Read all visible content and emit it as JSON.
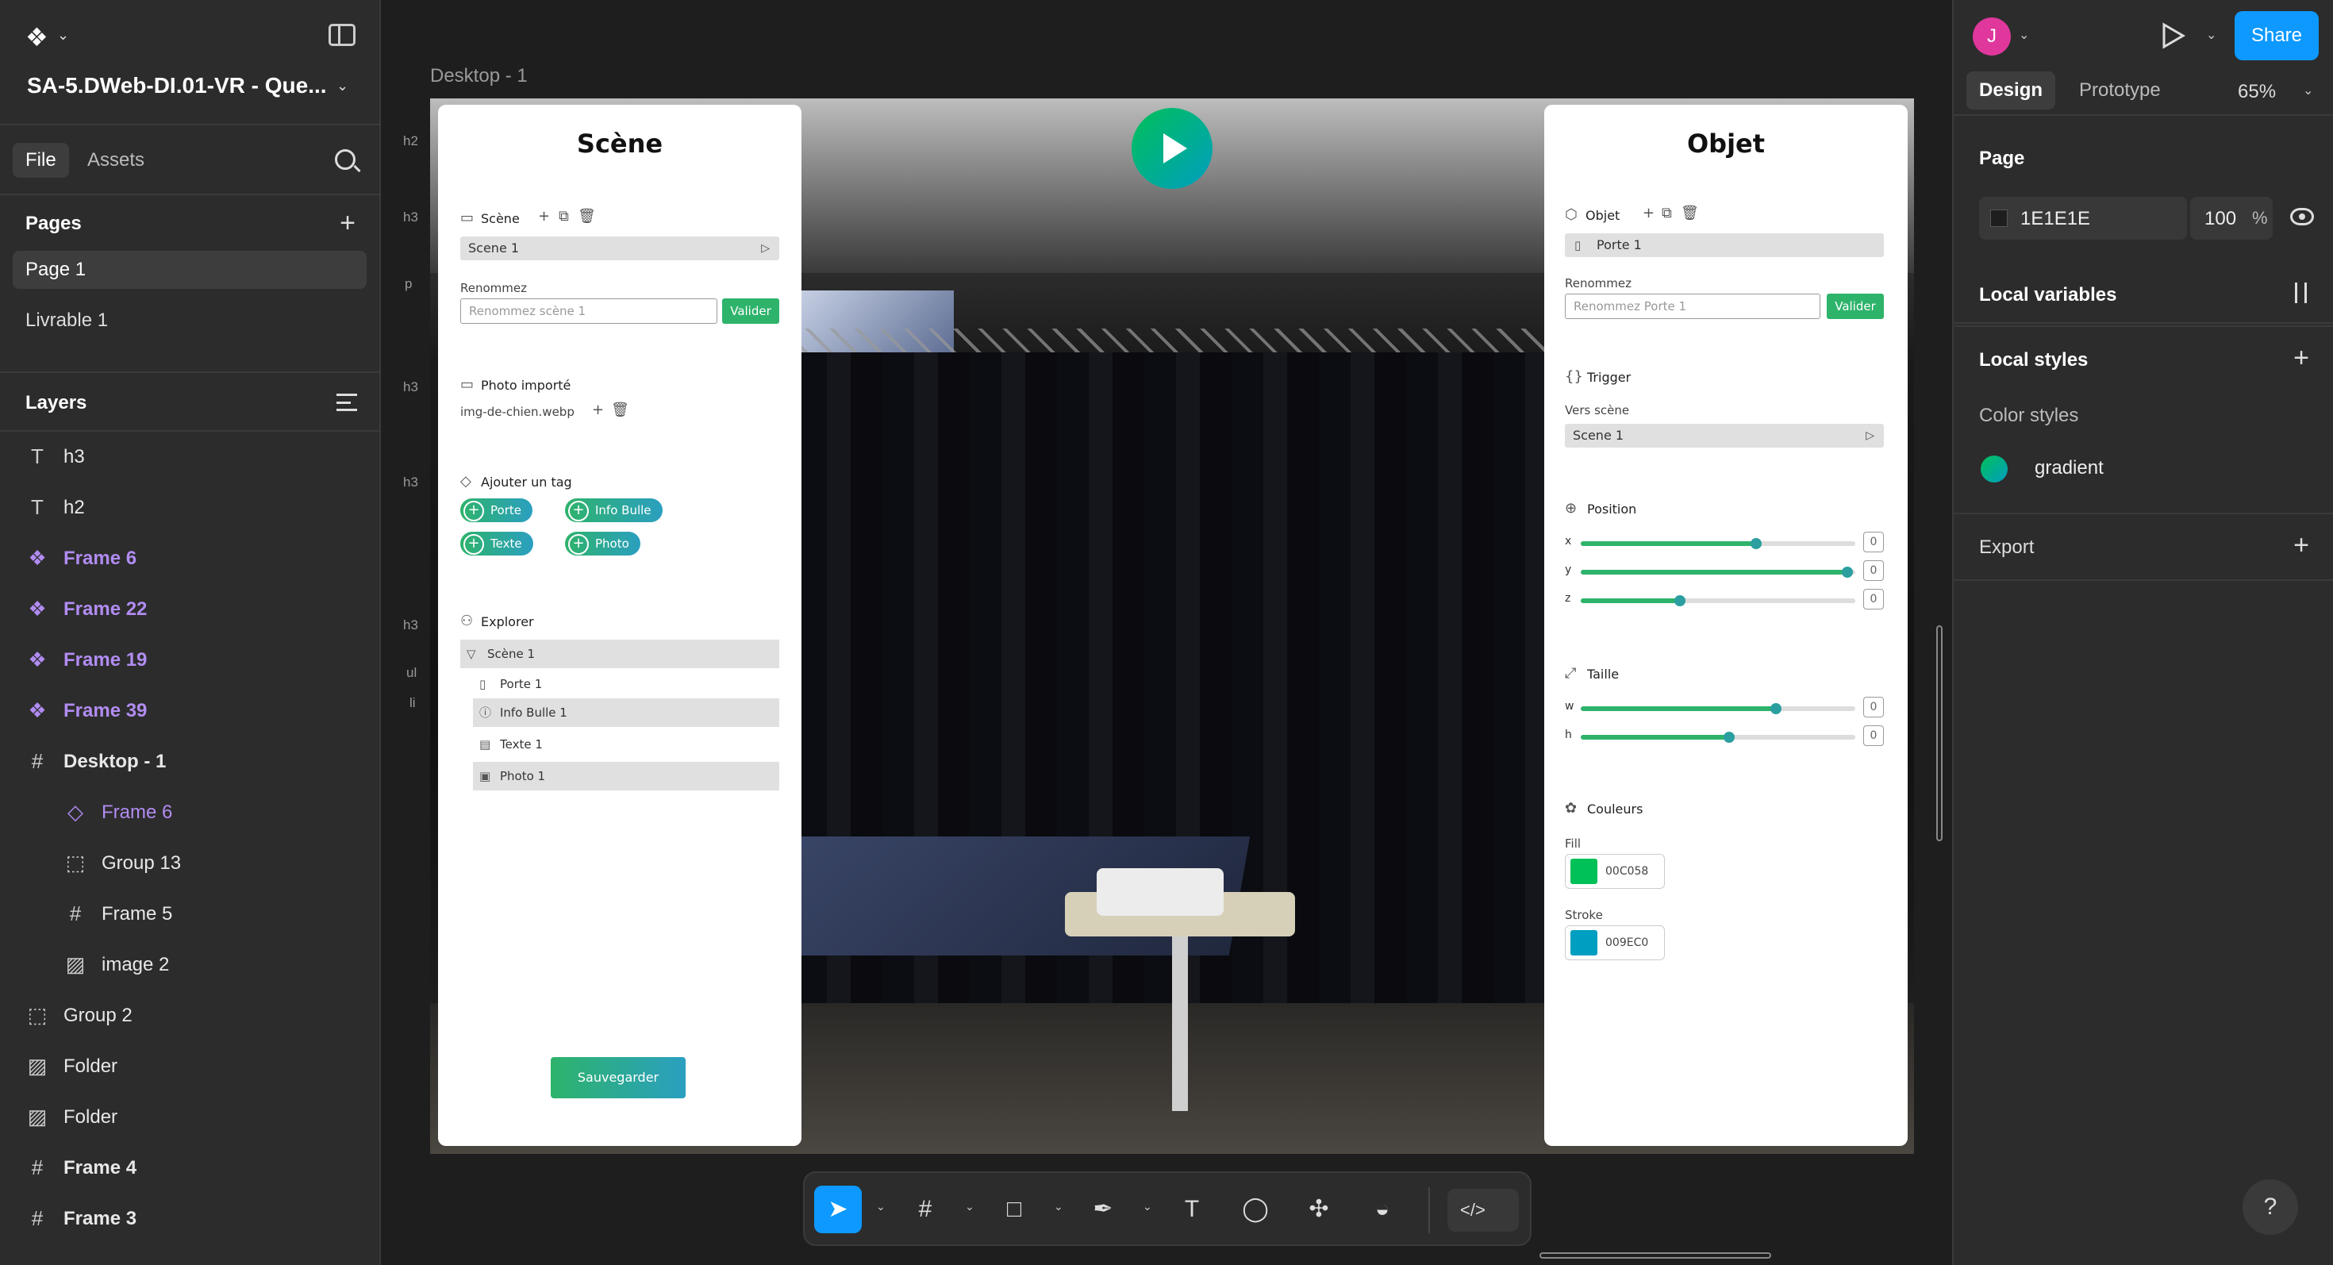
{
  "app": {
    "file_title": "SA-5.DWeb-DI.01-VR - Que...",
    "tabs": {
      "file": "File",
      "assets": "Assets"
    }
  },
  "pages": {
    "header": "Pages",
    "items": [
      "Page 1",
      "Livrable 1"
    ]
  },
  "layers": {
    "header": "Layers",
    "items": [
      {
        "label": "h3",
        "icon": "text-icon"
      },
      {
        "label": "h2",
        "icon": "text-icon"
      },
      {
        "label": "Frame 6",
        "icon": "component-icon"
      },
      {
        "label": "Frame 22",
        "icon": "component-icon"
      },
      {
        "label": "Frame 19",
        "icon": "component-icon"
      },
      {
        "label": "Frame 39",
        "icon": "component-icon"
      },
      {
        "label": "Desktop - 1",
        "icon": "frame-icon"
      },
      {
        "label": "Frame 6",
        "icon": "instance-icon"
      },
      {
        "label": "Group 13",
        "icon": "group-icon"
      },
      {
        "label": "Frame 5",
        "icon": "frame-icon"
      },
      {
        "label": "image 2",
        "icon": "image-icon"
      },
      {
        "label": "Group 2",
        "icon": "group-icon"
      },
      {
        "label": "Folder",
        "icon": "image-icon"
      },
      {
        "label": "Folder",
        "icon": "image-icon"
      },
      {
        "label": "Frame 4",
        "icon": "frame-icon"
      },
      {
        "label": "Frame 3",
        "icon": "frame-icon"
      }
    ]
  },
  "canvas": {
    "frame_label": "Desktop - 1",
    "tag_marks": [
      "h2",
      "h3",
      "p",
      "h3",
      "h3",
      "h3",
      "ul",
      "li"
    ]
  },
  "scene_panel": {
    "title": "Scène",
    "scene_label": "Scène",
    "scene_value": "Scene 1",
    "rename_label": "Renommez",
    "rename_placeholder": "Renommez scène 1",
    "validate": "Valider",
    "photo_label": "Photo importé",
    "photo_file": "img-de-chien.webp",
    "tag_label": "Ajouter un tag",
    "tags": [
      "Porte",
      "Info Bulle",
      "Texte",
      "Photo"
    ],
    "explorer_label": "Explorer",
    "explorer_items": [
      "Scène 1",
      "Porte 1",
      "Info Bulle 1",
      "Texte 1",
      "Photo 1"
    ],
    "save": "Sauvegarder"
  },
  "object_panel": {
    "title": "Objet",
    "object_label": "Objet",
    "object_value": "Porte 1",
    "rename_label": "Renommez",
    "rename_placeholder": "Renommez Porte 1",
    "validate": "Valider",
    "trigger_label": "Trigger",
    "target_label": "Vers scène",
    "target_value": "Scene 1",
    "position_label": "Position",
    "position": [
      {
        "axis": "x",
        "fraction": 0.64,
        "value": "0"
      },
      {
        "axis": "y",
        "fraction": 0.97,
        "value": "0"
      },
      {
        "axis": "z",
        "fraction": 0.36,
        "value": "0"
      }
    ],
    "size_label": "Taille",
    "size": [
      {
        "axis": "w",
        "fraction": 0.71,
        "value": "0"
      },
      {
        "axis": "h",
        "fraction": 0.54,
        "value": "0"
      }
    ],
    "colors_label": "Couleurs",
    "fill_label": "Fill",
    "fill_hex": "00C058",
    "fill_color": "#00C058",
    "stroke_label": "Stroke",
    "stroke_hex": "009EC0",
    "stroke_color": "#009EC0"
  },
  "right_panel": {
    "avatar": "J",
    "share": "Share",
    "tabs": {
      "design": "Design",
      "prototype": "Prototype"
    },
    "zoom": "65%",
    "page_label": "Page",
    "page_color": "1E1E1E",
    "page_opacity": "100",
    "percent": "%",
    "local_variables": "Local variables",
    "local_styles": "Local styles",
    "color_styles": "Color styles",
    "style_name": "gradient",
    "export": "Export"
  },
  "toolbar": {
    "tools": [
      "move-tool",
      "frame-tool",
      "shape-tool",
      "pen-tool",
      "text-tool",
      "comment-tool",
      "actions-tool",
      "plugin-tool"
    ],
    "dev_mode": "</>"
  },
  "help": "?",
  "colors": {
    "accent": "#0d99ff",
    "brand_green": "#00C058",
    "brand_blue": "#009EC0"
  }
}
